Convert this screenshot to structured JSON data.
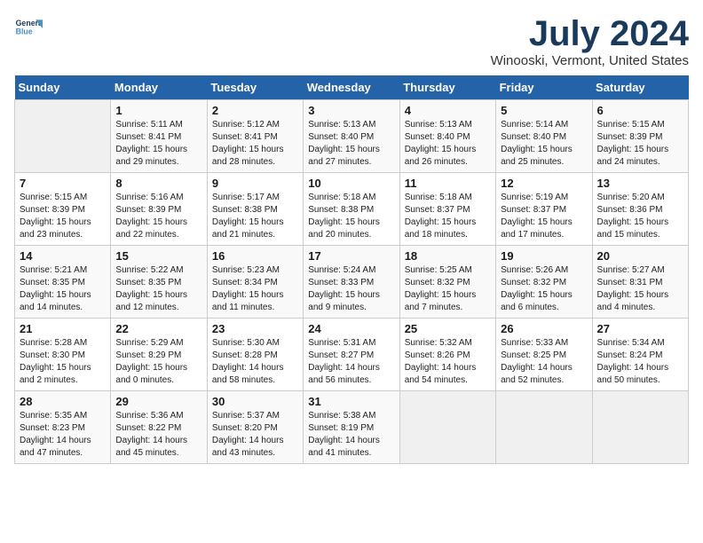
{
  "logo": {
    "line1": "General",
    "line2": "Blue"
  },
  "title": "July 2024",
  "subtitle": "Winooski, Vermont, United States",
  "days_of_week": [
    "Sunday",
    "Monday",
    "Tuesday",
    "Wednesday",
    "Thursday",
    "Friday",
    "Saturday"
  ],
  "weeks": [
    [
      {
        "day": "",
        "info": ""
      },
      {
        "day": "1",
        "info": "Sunrise: 5:11 AM\nSunset: 8:41 PM\nDaylight: 15 hours\nand 29 minutes."
      },
      {
        "day": "2",
        "info": "Sunrise: 5:12 AM\nSunset: 8:41 PM\nDaylight: 15 hours\nand 28 minutes."
      },
      {
        "day": "3",
        "info": "Sunrise: 5:13 AM\nSunset: 8:40 PM\nDaylight: 15 hours\nand 27 minutes."
      },
      {
        "day": "4",
        "info": "Sunrise: 5:13 AM\nSunset: 8:40 PM\nDaylight: 15 hours\nand 26 minutes."
      },
      {
        "day": "5",
        "info": "Sunrise: 5:14 AM\nSunset: 8:40 PM\nDaylight: 15 hours\nand 25 minutes."
      },
      {
        "day": "6",
        "info": "Sunrise: 5:15 AM\nSunset: 8:39 PM\nDaylight: 15 hours\nand 24 minutes."
      }
    ],
    [
      {
        "day": "7",
        "info": "Sunrise: 5:15 AM\nSunset: 8:39 PM\nDaylight: 15 hours\nand 23 minutes."
      },
      {
        "day": "8",
        "info": "Sunrise: 5:16 AM\nSunset: 8:39 PM\nDaylight: 15 hours\nand 22 minutes."
      },
      {
        "day": "9",
        "info": "Sunrise: 5:17 AM\nSunset: 8:38 PM\nDaylight: 15 hours\nand 21 minutes."
      },
      {
        "day": "10",
        "info": "Sunrise: 5:18 AM\nSunset: 8:38 PM\nDaylight: 15 hours\nand 20 minutes."
      },
      {
        "day": "11",
        "info": "Sunrise: 5:18 AM\nSunset: 8:37 PM\nDaylight: 15 hours\nand 18 minutes."
      },
      {
        "day": "12",
        "info": "Sunrise: 5:19 AM\nSunset: 8:37 PM\nDaylight: 15 hours\nand 17 minutes."
      },
      {
        "day": "13",
        "info": "Sunrise: 5:20 AM\nSunset: 8:36 PM\nDaylight: 15 hours\nand 15 minutes."
      }
    ],
    [
      {
        "day": "14",
        "info": "Sunrise: 5:21 AM\nSunset: 8:35 PM\nDaylight: 15 hours\nand 14 minutes."
      },
      {
        "day": "15",
        "info": "Sunrise: 5:22 AM\nSunset: 8:35 PM\nDaylight: 15 hours\nand 12 minutes."
      },
      {
        "day": "16",
        "info": "Sunrise: 5:23 AM\nSunset: 8:34 PM\nDaylight: 15 hours\nand 11 minutes."
      },
      {
        "day": "17",
        "info": "Sunrise: 5:24 AM\nSunset: 8:33 PM\nDaylight: 15 hours\nand 9 minutes."
      },
      {
        "day": "18",
        "info": "Sunrise: 5:25 AM\nSunset: 8:32 PM\nDaylight: 15 hours\nand 7 minutes."
      },
      {
        "day": "19",
        "info": "Sunrise: 5:26 AM\nSunset: 8:32 PM\nDaylight: 15 hours\nand 6 minutes."
      },
      {
        "day": "20",
        "info": "Sunrise: 5:27 AM\nSunset: 8:31 PM\nDaylight: 15 hours\nand 4 minutes."
      }
    ],
    [
      {
        "day": "21",
        "info": "Sunrise: 5:28 AM\nSunset: 8:30 PM\nDaylight: 15 hours\nand 2 minutes."
      },
      {
        "day": "22",
        "info": "Sunrise: 5:29 AM\nSunset: 8:29 PM\nDaylight: 15 hours\nand 0 minutes."
      },
      {
        "day": "23",
        "info": "Sunrise: 5:30 AM\nSunset: 8:28 PM\nDaylight: 14 hours\nand 58 minutes."
      },
      {
        "day": "24",
        "info": "Sunrise: 5:31 AM\nSunset: 8:27 PM\nDaylight: 14 hours\nand 56 minutes."
      },
      {
        "day": "25",
        "info": "Sunrise: 5:32 AM\nSunset: 8:26 PM\nDaylight: 14 hours\nand 54 minutes."
      },
      {
        "day": "26",
        "info": "Sunrise: 5:33 AM\nSunset: 8:25 PM\nDaylight: 14 hours\nand 52 minutes."
      },
      {
        "day": "27",
        "info": "Sunrise: 5:34 AM\nSunset: 8:24 PM\nDaylight: 14 hours\nand 50 minutes."
      }
    ],
    [
      {
        "day": "28",
        "info": "Sunrise: 5:35 AM\nSunset: 8:23 PM\nDaylight: 14 hours\nand 47 minutes."
      },
      {
        "day": "29",
        "info": "Sunrise: 5:36 AM\nSunset: 8:22 PM\nDaylight: 14 hours\nand 45 minutes."
      },
      {
        "day": "30",
        "info": "Sunrise: 5:37 AM\nSunset: 8:20 PM\nDaylight: 14 hours\nand 43 minutes."
      },
      {
        "day": "31",
        "info": "Sunrise: 5:38 AM\nSunset: 8:19 PM\nDaylight: 14 hours\nand 41 minutes."
      },
      {
        "day": "",
        "info": ""
      },
      {
        "day": "",
        "info": ""
      },
      {
        "day": "",
        "info": ""
      }
    ]
  ]
}
